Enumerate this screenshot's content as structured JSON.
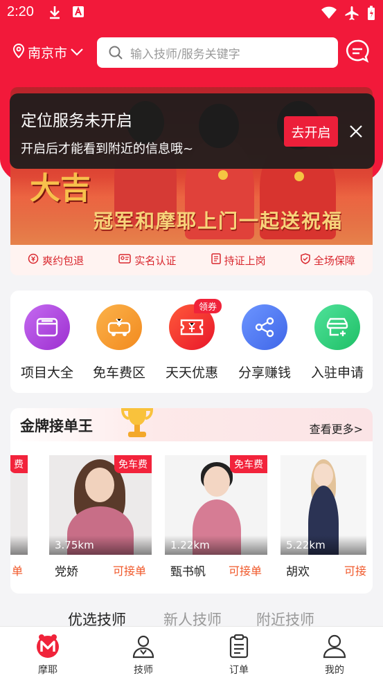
{
  "status_bar": {
    "time": "2:20"
  },
  "location": {
    "city": "南京市"
  },
  "search": {
    "placeholder": "输入技师/服务关键字"
  },
  "banner": {
    "headline": "冠军和摩耶上门一起送祝福",
    "big_text": "大吉"
  },
  "toast": {
    "title": "定位服务未开启",
    "subtitle": "开启后才能看到附近的信息哦~",
    "button_label": "去开启"
  },
  "features": [
    {
      "label": "爽约包退",
      "icon": "refund-icon"
    },
    {
      "label": "实名认证",
      "icon": "id-card-icon"
    },
    {
      "label": "持证上岗",
      "icon": "certificate-icon"
    },
    {
      "label": "全场保障",
      "icon": "shield-icon"
    }
  ],
  "categories": [
    {
      "label": "项目大全",
      "icon": "catalog-icon",
      "color": "#b44de0"
    },
    {
      "label": "免车费区",
      "icon": "car-free-icon",
      "color": "#f79a2b"
    },
    {
      "label": "天天优惠",
      "icon": "ticket-icon",
      "color": "#f0262e"
    },
    {
      "label": "分享赚钱",
      "icon": "share-icon",
      "color": "#4f7ef2"
    },
    {
      "label": "入驻申请",
      "icon": "join-icon",
      "color": "#2fcf7a"
    }
  ],
  "coupon_badge": "领券",
  "gold_section": {
    "title": "金牌接单王",
    "more_label": "查看更多>",
    "technicians": [
      {
        "name": "",
        "distance": "",
        "status": "单",
        "free_tag": "费"
      },
      {
        "name": "党娇",
        "distance": "3.75km",
        "status": "可接单",
        "free_tag": "免车费"
      },
      {
        "name": "甄书帆",
        "distance": "1.22km",
        "status": "可接单",
        "free_tag": "免车费"
      },
      {
        "name": "胡欢",
        "distance": "5.22km",
        "status": "可接",
        "free_tag": ""
      }
    ]
  },
  "tabs": [
    {
      "label": "优选技师",
      "active": true
    },
    {
      "label": "新人技师",
      "active": false
    },
    {
      "label": "附近技师",
      "active": false
    }
  ],
  "bottom_nav": [
    {
      "label": "摩耶",
      "icon": "home-logo-icon",
      "active": true
    },
    {
      "label": "技师",
      "icon": "technician-icon",
      "active": false
    },
    {
      "label": "订单",
      "icon": "order-icon",
      "active": false
    },
    {
      "label": "我的",
      "icon": "profile-icon",
      "active": false
    }
  ],
  "colors": {
    "brand": "#f2193a",
    "accent_orange": "#f0582a"
  }
}
